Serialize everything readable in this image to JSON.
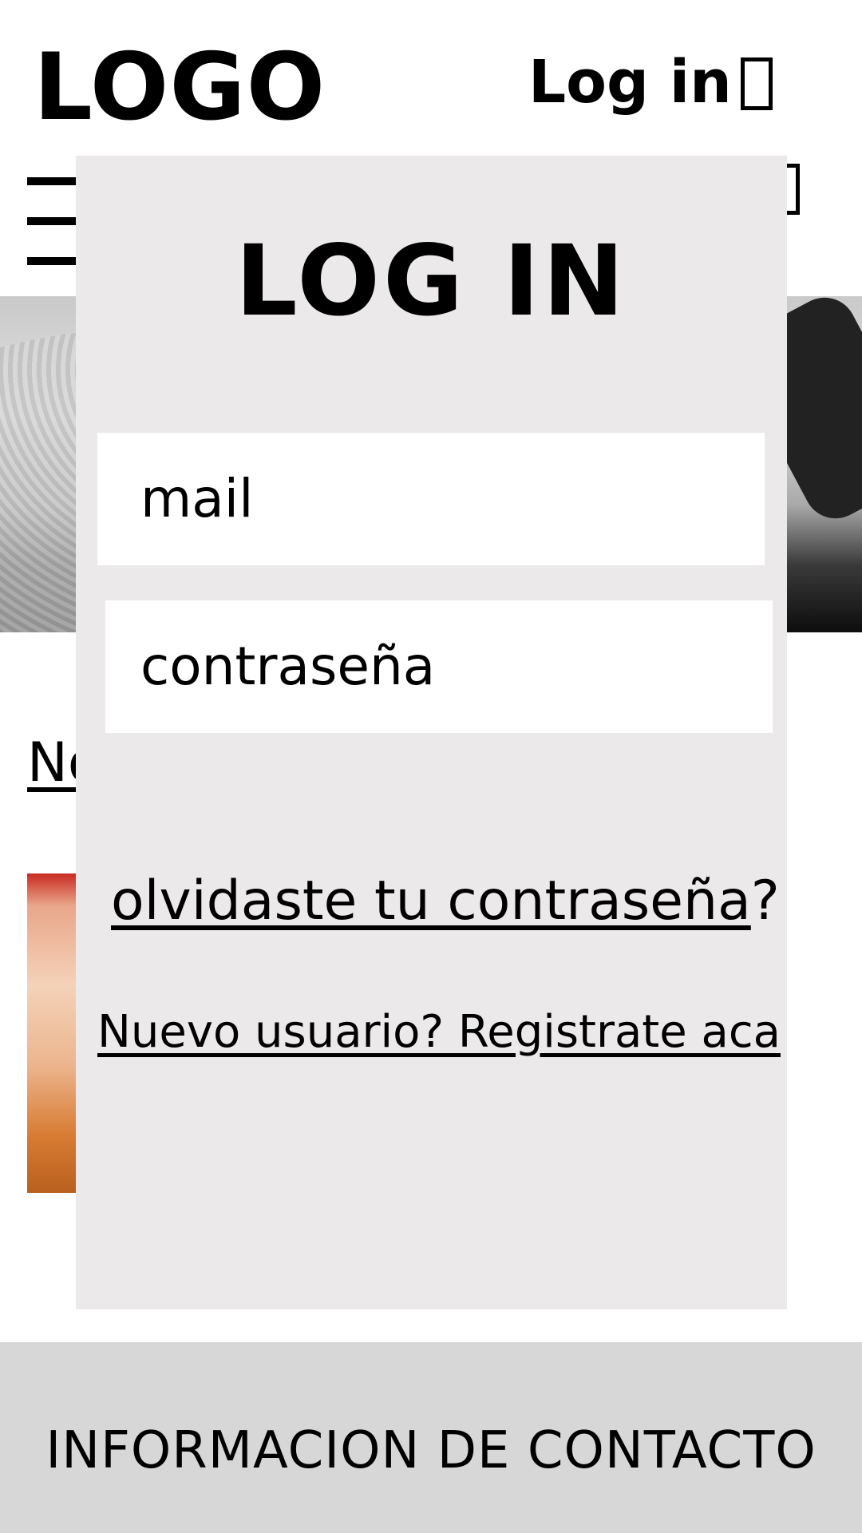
{
  "header": {
    "logo_text": "LOGO",
    "login_label": "Log in"
  },
  "main": {
    "section_link_partial": "No"
  },
  "login_modal": {
    "title": "LOG IN",
    "email_field_text": "mail",
    "password_field_text": "contraseña",
    "forgot_link": "olvidaste tu contraseña",
    "forgot_suffix": "?",
    "register_link": "Nuevo usuario? Registrate aca"
  },
  "footer": {
    "title": "INFORMACION DE CONTACTO"
  },
  "colors": {
    "modal_background": "#ece9ea",
    "footer_background": "#d7d7d7",
    "field_background": "#ffffff",
    "text": "#000000"
  },
  "icons": [
    "cart-icon",
    "menu-icon"
  ]
}
